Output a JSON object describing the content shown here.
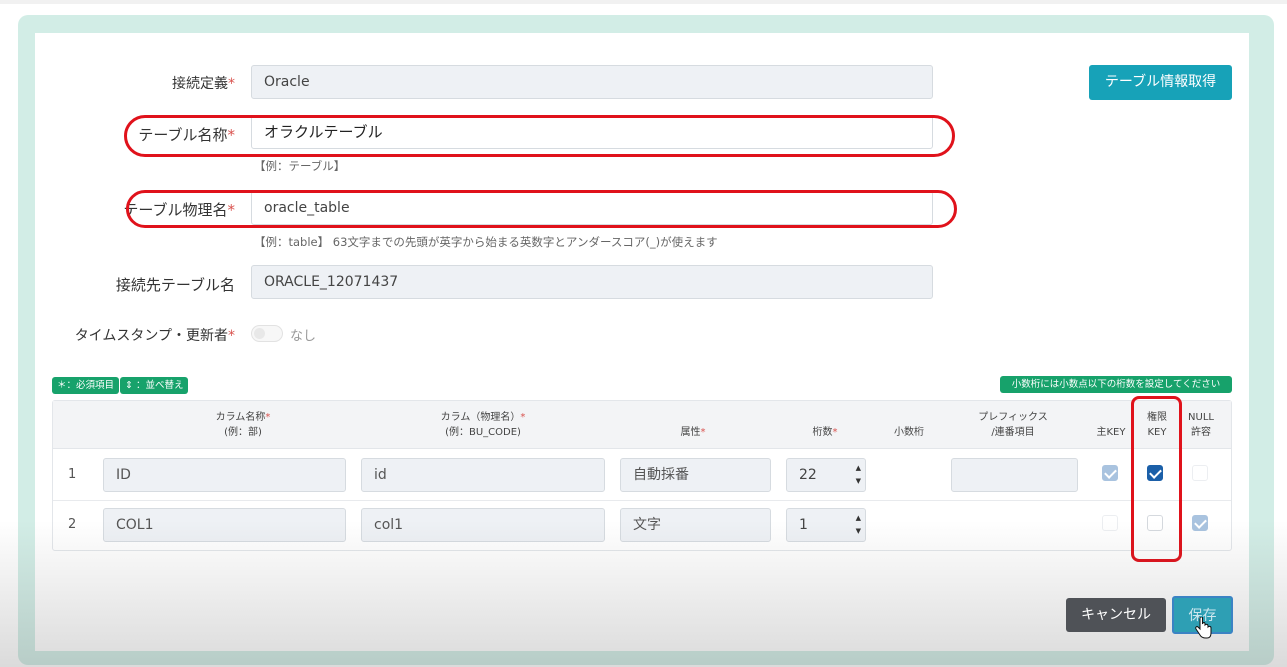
{
  "form": {
    "connection_label": "接続定義",
    "connection_value": "Oracle",
    "table_name_label": "テーブル名称",
    "table_name_value": "オラクルテーブル",
    "table_name_hint": "【例：テーブル】",
    "physical_label": "テーブル物理名",
    "physical_value": "oracle_table",
    "physical_hint": "【例：table】 63文字までの先頭が英字から始まる英数字とアンダースコア(_)が使えます",
    "dest_label": "接続先テーブル名",
    "dest_value": "ORACLE_12071437",
    "timestamp_label": "タイムスタンプ・更新者",
    "timestamp_toggle_text": "なし",
    "required_mark": "*"
  },
  "buttons": {
    "fetch": "テーブル情報取得",
    "cancel": "キャンセル",
    "save": "保存"
  },
  "badges": {
    "required": "＊：必須項目",
    "sort": "⇕ ：並べ替え",
    "decimal_note": "小数桁には小数点以下の桁数を設定してください"
  },
  "table": {
    "headers": {
      "col_name": "カラム名称",
      "col_name_ex": "(例：部)",
      "col_phys": "カラム（物理名）",
      "col_phys_ex": "(例：BU_CODE)",
      "attr": "属性",
      "digits": "桁数",
      "decimal": "小数桁",
      "prefix": "プレフィックス",
      "prefix2": "/連番項目",
      "pk": "主KEY",
      "auth1": "権限",
      "auth2": "KEY",
      "null1": "NULL",
      "null2": "許容"
    },
    "rows": [
      {
        "num": "1",
        "name": "ID",
        "phys": "id",
        "attr": "自動採番",
        "digits": "22"
      },
      {
        "num": "2",
        "name": "COL1",
        "phys": "col1",
        "attr": "文字",
        "digits": "1"
      }
    ]
  },
  "colors": {
    "accent": "#17a2b8",
    "highlight": "#e0121b",
    "badge": "#17a26b",
    "required": "#d9534f"
  }
}
